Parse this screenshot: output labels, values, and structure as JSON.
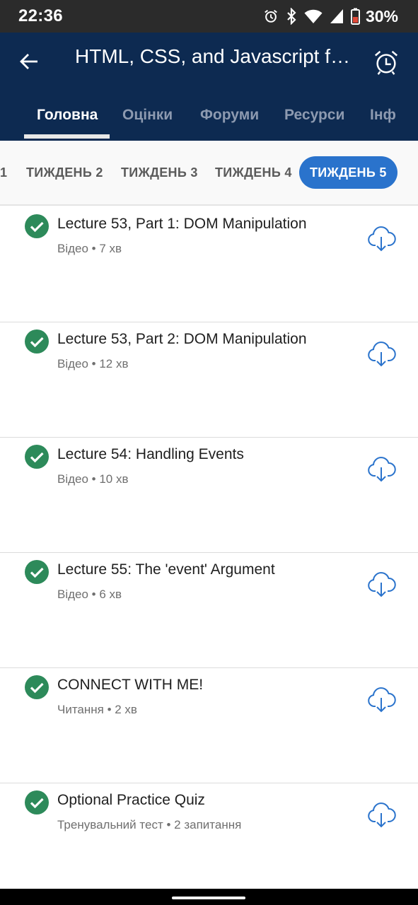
{
  "status": {
    "time": "22:36",
    "battery_percent": "30%",
    "icons": [
      "alarm-icon",
      "bluetooth-icon",
      "wifi-icon",
      "signal-icon",
      "battery-low-icon"
    ]
  },
  "appbar": {
    "title": "HTML, CSS, and Javascript for…",
    "back_icon": "arrow-left-icon",
    "reminder_icon": "alarm-clock-icon"
  },
  "tabs": [
    {
      "label": "Головна",
      "active": true
    },
    {
      "label": "Оцінки",
      "active": false
    },
    {
      "label": "Форуми",
      "active": false
    },
    {
      "label": "Ресурси",
      "active": false
    },
    {
      "label": "Інф",
      "active": false
    }
  ],
  "weeks": [
    {
      "label": "1",
      "active": false
    },
    {
      "label": "ТИЖДЕНЬ 2",
      "active": false
    },
    {
      "label": "ТИЖДЕНЬ 3",
      "active": false
    },
    {
      "label": "ТИЖДЕНЬ 4",
      "active": false
    },
    {
      "label": "ТИЖДЕНЬ 5",
      "active": true
    }
  ],
  "items": [
    {
      "title": "Lecture 53, Part 1: DOM Manipulation",
      "meta": "Відео • 7 хв",
      "completed": true
    },
    {
      "title": "Lecture 53, Part 2: DOM Manipulation",
      "meta": "Відео • 12 хв",
      "completed": true
    },
    {
      "title": "Lecture 54: Handling Events",
      "meta": "Відео • 10 хв",
      "completed": true
    },
    {
      "title": "Lecture 55: The 'event' Argument",
      "meta": "Відео • 6 хв",
      "completed": true
    },
    {
      "title": "CONNECT WITH ME!",
      "meta": "Читання • 2 хв",
      "completed": true
    },
    {
      "title": "Optional Practice Quiz",
      "meta": "Тренувальний тест • 2 запитання",
      "completed": true
    }
  ],
  "colors": {
    "header_bg": "#0d2a51",
    "accent_blue": "#2a73cc",
    "check_green": "#2d8a5a",
    "download_blue": "#2a73cc"
  }
}
